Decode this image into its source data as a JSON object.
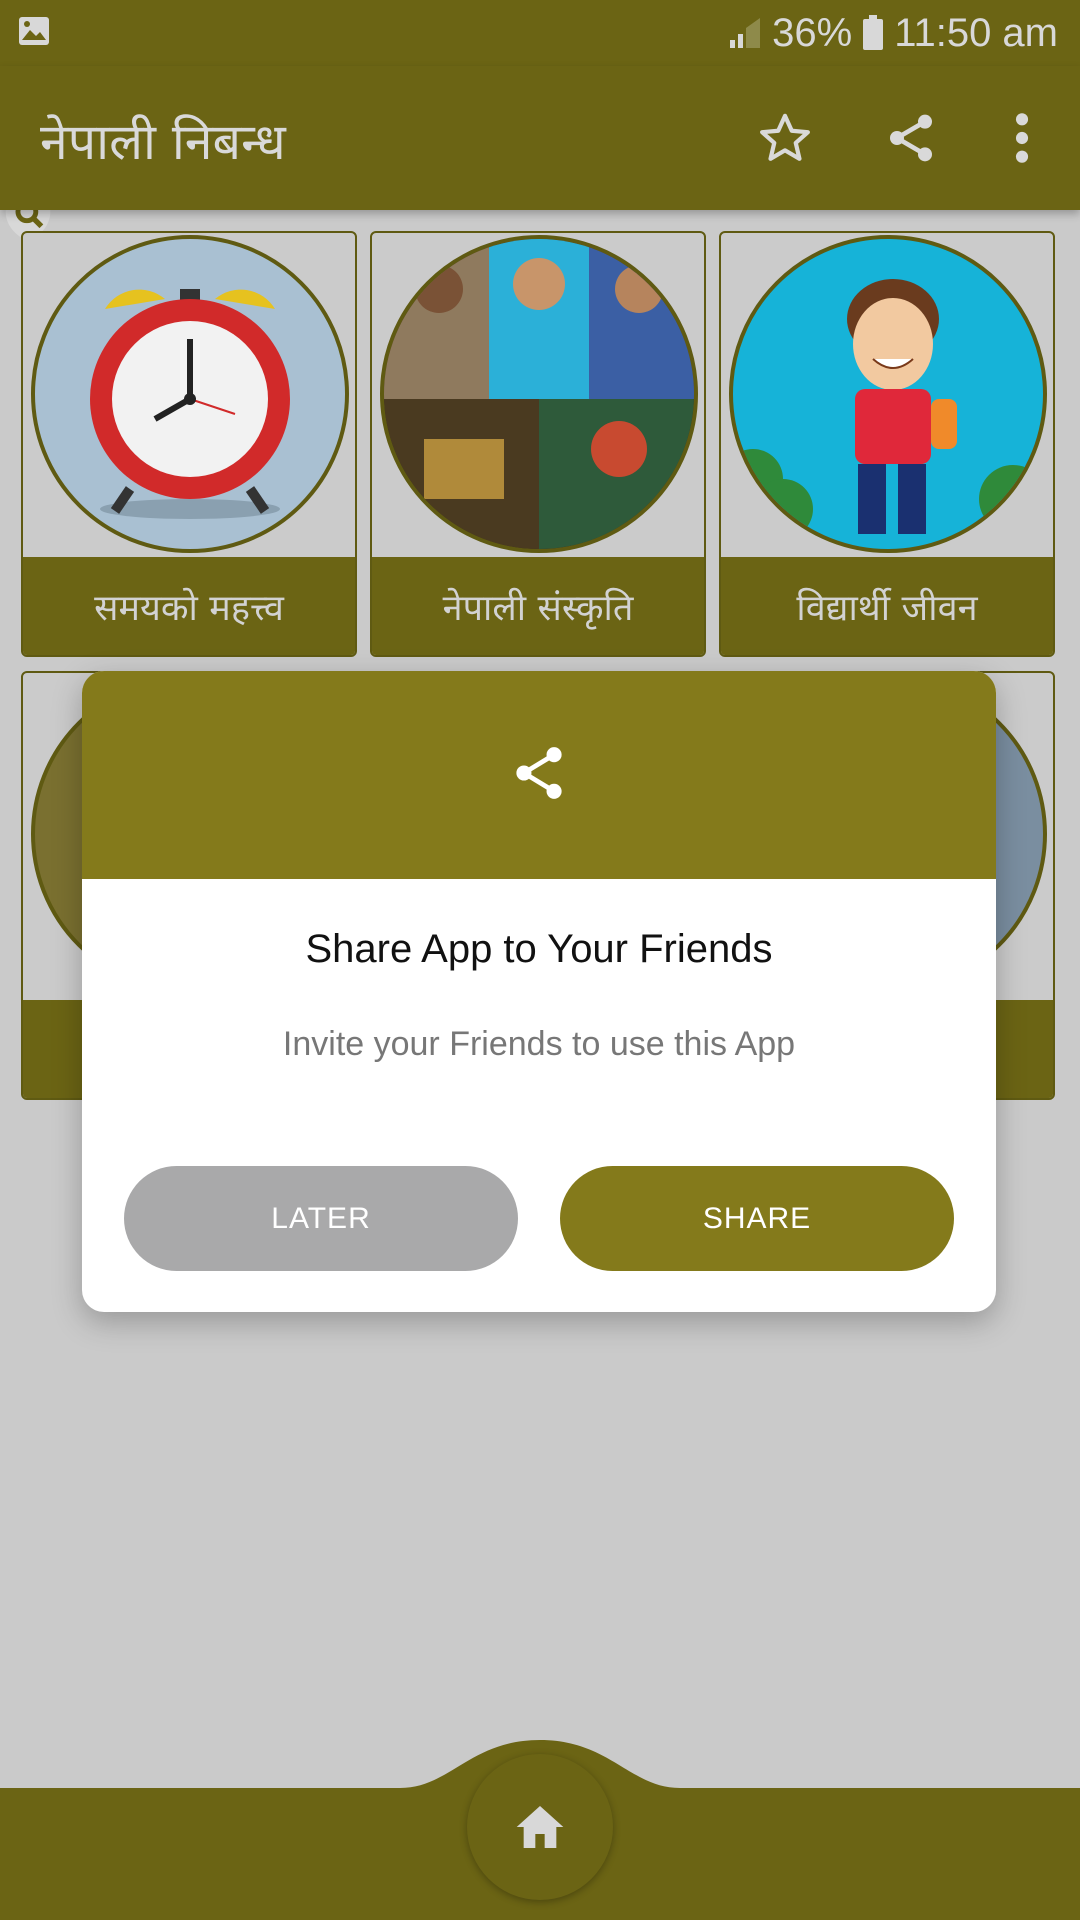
{
  "status_bar": {
    "battery": "36%",
    "time": "11:50 am"
  },
  "app_bar": {
    "title": "नेपाली निबन्ध"
  },
  "cards": [
    {
      "label": "समयको महत्त्व"
    },
    {
      "label": "नेपाली संस्कृति"
    },
    {
      "label": "विद्यार्थी जीवन"
    }
  ],
  "dialog": {
    "title": "Share App to Your Friends",
    "subtitle": "Invite your Friends to use this App",
    "later_label": "LATER",
    "share_label": "SHARE"
  },
  "icons": [
    "image-icon",
    "signal-icon",
    "battery-icon",
    "star-icon",
    "share-icon",
    "more-vert-icon",
    "contact-icon",
    "home-icon",
    "privacy-shield-icon"
  ],
  "colors": {
    "primary": "#6b6414",
    "accent": "#847a1b",
    "background": "#cacaca"
  }
}
